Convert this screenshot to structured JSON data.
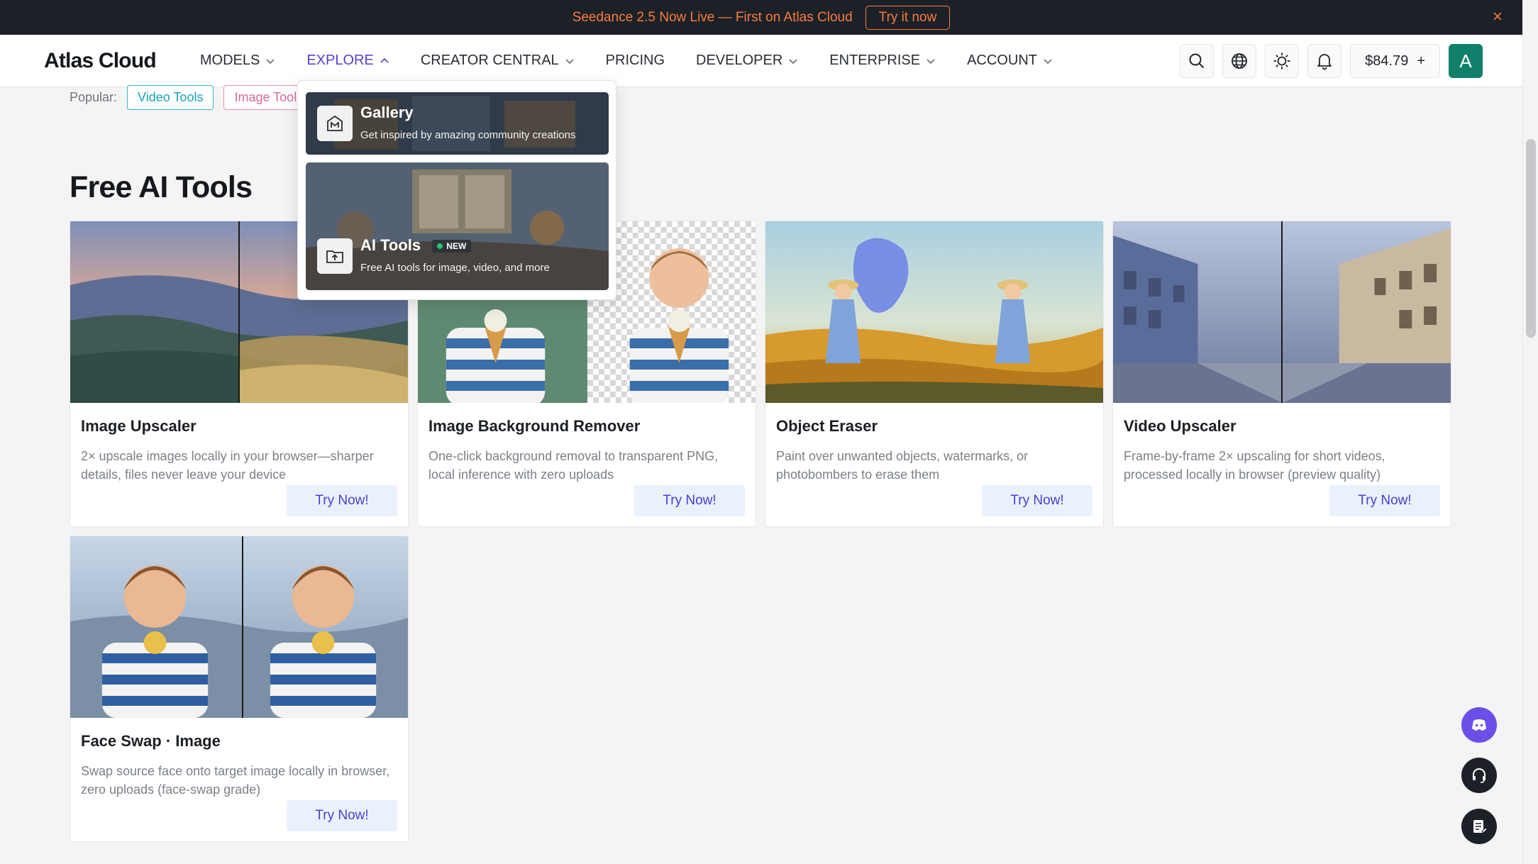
{
  "announcement": {
    "text": "Seedance 2.5 Now Live — First on Atlas Cloud",
    "cta": "Try it now",
    "close_icon": "×"
  },
  "header": {
    "logo": "Atlas Cloud",
    "nav": [
      {
        "label": "MODELS",
        "has_chevron": true
      },
      {
        "label": "EXPLORE",
        "has_chevron": true,
        "active": true
      },
      {
        "label": "CREATOR CENTRAL",
        "has_chevron": true
      },
      {
        "label": "PRICING",
        "has_chevron": false
      },
      {
        "label": "DEVELOPER",
        "has_chevron": true
      },
      {
        "label": "ENTERPRISE",
        "has_chevron": true
      },
      {
        "label": "ACCOUNT",
        "has_chevron": true
      }
    ],
    "balance": "$84.79",
    "balance_plus": "+",
    "avatar_letter": "A",
    "icons": [
      "search-icon",
      "globe-icon",
      "sun-icon",
      "bell-icon"
    ]
  },
  "popular": {
    "label": "Popular:",
    "tags": [
      "Video Tools",
      "Image Tools"
    ]
  },
  "section_title": "Free AI Tools",
  "explore_menu": {
    "items": [
      {
        "title": "Gallery",
        "desc": "Get inspired by amazing community creations",
        "icon": "gallery-icon"
      },
      {
        "title": "AI Tools",
        "badge": "NEW",
        "desc": "Free AI tools for image, video, and more",
        "icon": "upload-folder-icon"
      }
    ]
  },
  "tools": [
    {
      "title": "Image Upscaler",
      "desc": "2× upscale images locally in your browser—sharper details, files never leave your device",
      "button": "Try Now!"
    },
    {
      "title": "Image Background Remover",
      "desc": "One-click background removal to transparent PNG, local inference with zero uploads",
      "button": "Try Now!"
    },
    {
      "title": "Object Eraser",
      "desc": "Paint over unwanted objects, watermarks, or photobombers to erase them",
      "button": "Try Now!"
    },
    {
      "title": "Video Upscaler",
      "desc": "Frame-by-frame 2× upscaling for short videos, processed locally in browser (preview quality)",
      "button": "Try Now!"
    },
    {
      "title": "Face Swap · Image",
      "desc": "Swap source face onto target image locally in browser, zero uploads (face-swap grade)",
      "button": "Try Now!"
    }
  ],
  "colors": {
    "accent": "#5b3fd1",
    "announce_bg": "#1c2128",
    "announce_text": "#f97b3d",
    "avatar_bg": "#11806a",
    "discord": "#6c4fe8"
  }
}
